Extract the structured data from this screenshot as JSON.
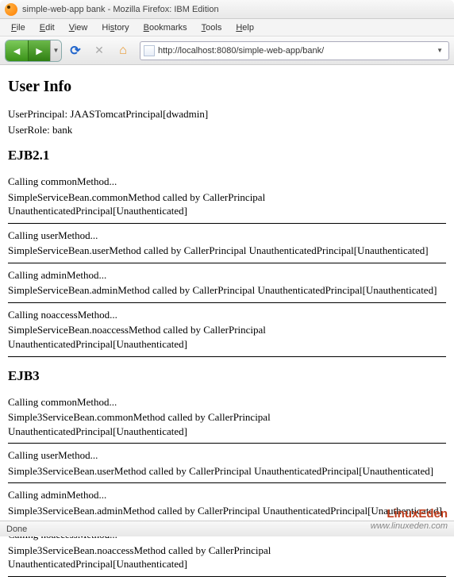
{
  "window": {
    "title": "simple-web-app bank - Mozilla Firefox: IBM Edition"
  },
  "menubar": {
    "file": "File",
    "edit": "Edit",
    "view": "View",
    "history": "History",
    "bookmarks": "Bookmarks",
    "tools": "Tools",
    "help": "Help"
  },
  "toolbar": {
    "url": "http://localhost:8080/simple-web-app/bank/"
  },
  "page": {
    "userinfo": {
      "heading": "User Info",
      "principal": "UserPrincipal: JAASTomcatPrincipal[dwadmin]",
      "role": "UserRole: bank"
    },
    "ejb21": {
      "heading": "EJB2.1",
      "blocks": [
        {
          "call": "Calling commonMethod...",
          "result": "SimpleServiceBean.commonMethod called by CallerPrincipal UnauthenticatedPrincipal[Unauthenticated]"
        },
        {
          "call": "Calling userMethod...",
          "result": "SimpleServiceBean.userMethod called by CallerPrincipal UnauthenticatedPrincipal[Unauthenticated]"
        },
        {
          "call": "Calling adminMethod...",
          "result": "SimpleServiceBean.adminMethod called by CallerPrincipal UnauthenticatedPrincipal[Unauthenticated]"
        },
        {
          "call": "Calling noaccessMethod...",
          "result": "SimpleServiceBean.noaccessMethod called by CallerPrincipal UnauthenticatedPrincipal[Unauthenticated]"
        }
      ]
    },
    "ejb3": {
      "heading": "EJB3",
      "blocks": [
        {
          "call": "Calling commonMethod...",
          "result": "Simple3ServiceBean.commonMethod called by CallerPrincipal UnauthenticatedPrincipal[Unauthenticated]"
        },
        {
          "call": "Calling userMethod...",
          "result": "Simple3ServiceBean.userMethod called by CallerPrincipal UnauthenticatedPrincipal[Unauthenticated]"
        },
        {
          "call": "Calling adminMethod...",
          "result": "Simple3ServiceBean.adminMethod called by CallerPrincipal UnauthenticatedPrincipal[Unauthenticated]"
        },
        {
          "call": "Calling noaccessMethod...",
          "result": "Simple3ServiceBean.noaccessMethod called by CallerPrincipal UnauthenticatedPrincipal[Unauthenticated]"
        }
      ]
    }
  },
  "statusbar": {
    "text": "Done"
  },
  "watermark": {
    "brand": "LinuxEden",
    "url": "www.linuxeden.com"
  }
}
